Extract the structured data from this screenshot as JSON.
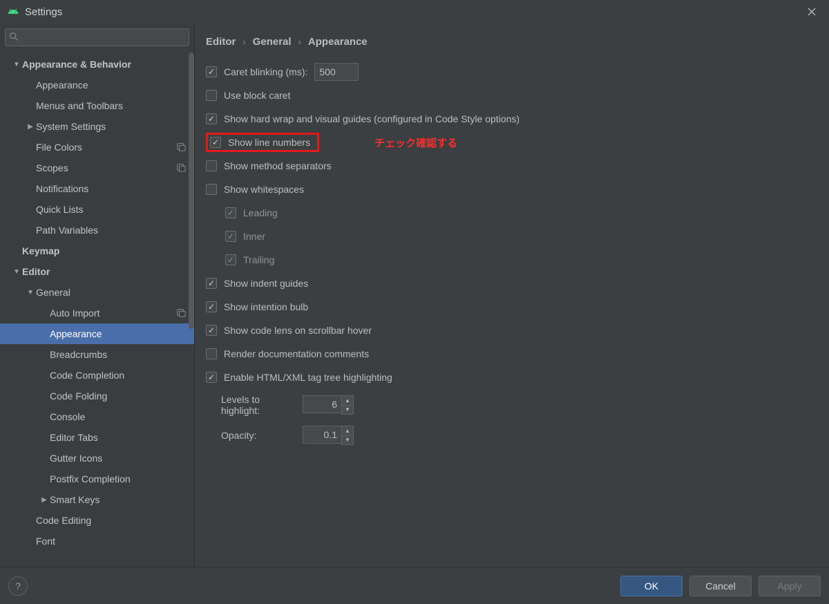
{
  "window": {
    "title": "Settings"
  },
  "search": {
    "placeholder": ""
  },
  "sidebar": {
    "items": [
      {
        "label": "Appearance & Behavior",
        "depth": 0,
        "arrow": "down",
        "bold": true
      },
      {
        "label": "Appearance",
        "depth": 1
      },
      {
        "label": "Menus and Toolbars",
        "depth": 1
      },
      {
        "label": "System Settings",
        "depth": 1,
        "arrow": "right"
      },
      {
        "label": "File Colors",
        "depth": 1,
        "overlay": true
      },
      {
        "label": "Scopes",
        "depth": 1,
        "overlay": true
      },
      {
        "label": "Notifications",
        "depth": 1
      },
      {
        "label": "Quick Lists",
        "depth": 1
      },
      {
        "label": "Path Variables",
        "depth": 1
      },
      {
        "label": "Keymap",
        "depth": 0,
        "bold": true
      },
      {
        "label": "Editor",
        "depth": 0,
        "arrow": "down",
        "bold": true
      },
      {
        "label": "General",
        "depth": 1,
        "arrow": "down"
      },
      {
        "label": "Auto Import",
        "depth": 2,
        "overlay": true
      },
      {
        "label": "Appearance",
        "depth": 2,
        "selected": true
      },
      {
        "label": "Breadcrumbs",
        "depth": 2
      },
      {
        "label": "Code Completion",
        "depth": 2
      },
      {
        "label": "Code Folding",
        "depth": 2
      },
      {
        "label": "Console",
        "depth": 2
      },
      {
        "label": "Editor Tabs",
        "depth": 2
      },
      {
        "label": "Gutter Icons",
        "depth": 2
      },
      {
        "label": "Postfix Completion",
        "depth": 2
      },
      {
        "label": "Smart Keys",
        "depth": 2,
        "arrow": "right"
      },
      {
        "label": "Code Editing",
        "depth": 1
      },
      {
        "label": "Font",
        "depth": 1
      }
    ]
  },
  "breadcrumb": {
    "a": "Editor",
    "b": "General",
    "c": "Appearance"
  },
  "settings": {
    "caret_blinking_label": "Caret blinking (ms):",
    "caret_blinking_value": "500",
    "use_block_caret": "Use block caret",
    "hard_wrap": "Show hard wrap and visual guides (configured in Code Style options)",
    "show_line_numbers": "Show line numbers",
    "annotation": "チェック確認する",
    "method_separators": "Show method separators",
    "show_whitespaces": "Show whitespaces",
    "ws_leading": "Leading",
    "ws_inner": "Inner",
    "ws_trailing": "Trailing",
    "indent_guides": "Show indent guides",
    "intention_bulb": "Show intention bulb",
    "code_lens": "Show code lens on scrollbar hover",
    "render_doc": "Render documentation comments",
    "enable_html_xml": "Enable HTML/XML tag tree highlighting",
    "levels_label": "Levels to highlight:",
    "levels_value": "6",
    "opacity_label": "Opacity:",
    "opacity_value": "0.1"
  },
  "buttons": {
    "ok": "OK",
    "cancel": "Cancel",
    "apply": "Apply",
    "help": "?"
  }
}
